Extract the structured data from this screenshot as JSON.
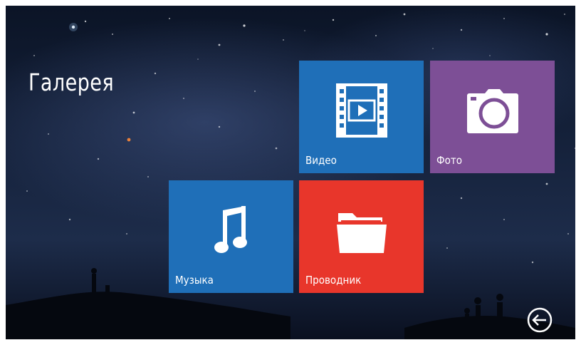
{
  "page": {
    "title": "Галерея"
  },
  "tiles": [
    {
      "id": "video",
      "label": "Видео",
      "icon": "film-play-icon",
      "color": "#1f6fb8"
    },
    {
      "id": "photo",
      "label": "Фото",
      "icon": "camera-icon",
      "color": "#7d4f96"
    },
    {
      "id": "music",
      "label": "Музыка",
      "icon": "music-note-icon",
      "color": "#1f6fb8"
    },
    {
      "id": "files",
      "label": "Проводник",
      "icon": "folder-icon",
      "color": "#e8362b"
    }
  ],
  "nav": {
    "back_icon": "back-arrow-icon"
  }
}
